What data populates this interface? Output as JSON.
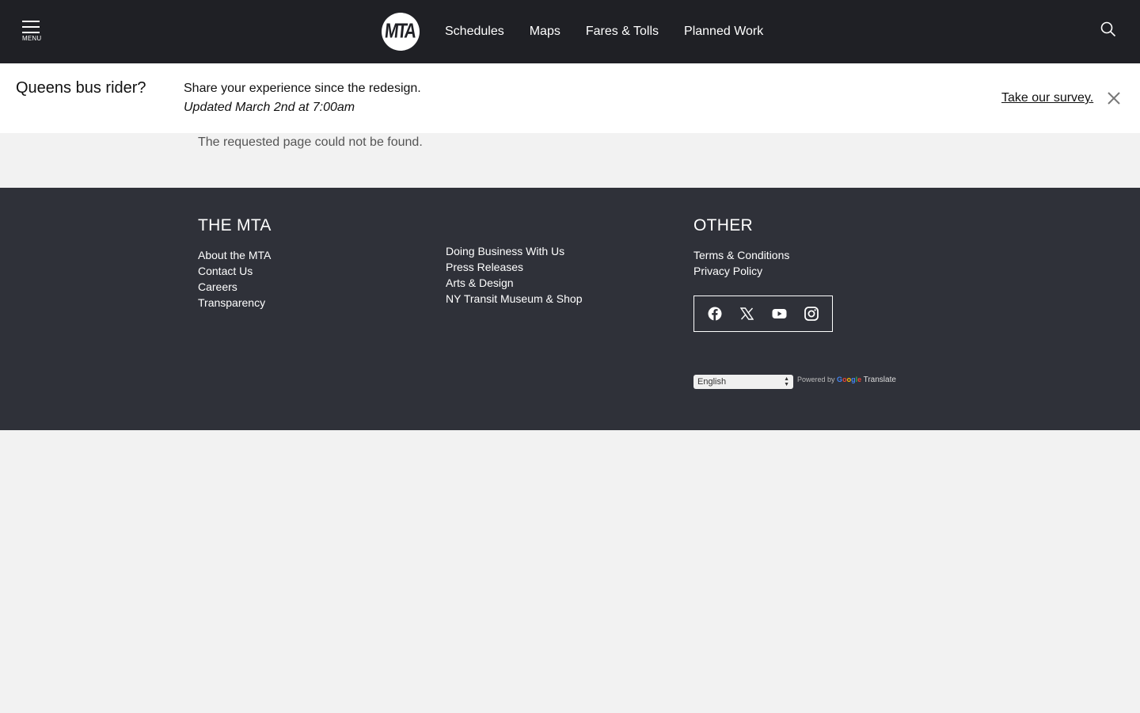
{
  "header": {
    "menu_label": "MENU",
    "logo_text": "MTA",
    "nav": [
      "Schedules",
      "Maps",
      "Fares & Tolls",
      "Planned Work"
    ]
  },
  "alert": {
    "title": "Queens bus rider?",
    "message": "Share your experience since the redesign.",
    "updated": "Updated March 2nd at 7:00am",
    "link": "Take our survey."
  },
  "main": {
    "message": "The requested page could not be found."
  },
  "footer": {
    "col1": {
      "heading": "THE MTA",
      "links": [
        "About the MTA",
        "Contact Us",
        "Careers",
        "Transparency"
      ]
    },
    "col2": {
      "links": [
        "Doing Business With Us",
        "Press Releases",
        "Arts & Design",
        "NY Transit Museum & Shop"
      ]
    },
    "col3": {
      "heading": "OTHER",
      "links": [
        "Terms & Conditions",
        "Privacy Policy"
      ]
    },
    "social": [
      "facebook-icon",
      "x-icon",
      "youtube-icon",
      "instagram-icon"
    ],
    "language": {
      "selected": "English",
      "powered_by": "Powered by",
      "google": "Google",
      "translate": "Translate"
    }
  },
  "colors": {
    "header_bg": "#1f2025",
    "footer_bg": "#2f3139",
    "page_bg": "#f2f2f2"
  }
}
